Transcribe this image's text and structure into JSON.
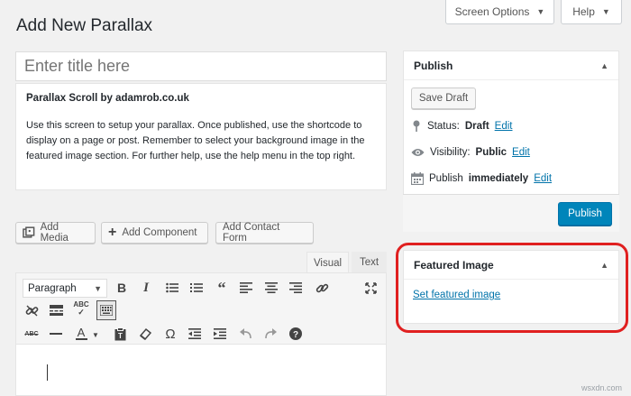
{
  "header": {
    "screen_options": "Screen Options",
    "help": "Help",
    "page_title": "Add New Parallax"
  },
  "title_field": {
    "placeholder": "Enter title here"
  },
  "notice": {
    "heading": "Parallax Scroll by adamrob.co.uk",
    "body": "Use this screen to setup your parallax. Once published, use the shortcode to display on a page or post. Remember to select your background image in the featured image section. For further help, use the help menu in the top right."
  },
  "media_buttons": {
    "add_media": "Add Media",
    "add_component": "Add Component",
    "add_contact_form": "Add Contact Form"
  },
  "editor_tabs": {
    "visual": "Visual",
    "text": "Text"
  },
  "toolbar": {
    "format_select": "Paragraph",
    "row1_icons": [
      "bold-icon",
      "italic-icon",
      "bullet-list-icon",
      "numbered-list-icon",
      "blockquote-icon",
      "align-left-icon",
      "align-center-icon",
      "align-right-icon",
      "link-icon",
      "fullscreen-icon"
    ],
    "row2_icons": [
      "unlink-icon",
      "read-more-icon",
      "spellcheck-icon",
      "toolbar-toggle-icon"
    ],
    "row3_icons": [
      "strikethrough-icon",
      "horizontal-line-icon",
      "text-color-icon",
      "paste-text-icon",
      "clear-formatting-icon",
      "special-character-icon",
      "outdent-icon",
      "indent-icon",
      "undo-icon",
      "redo-icon",
      "help-icon"
    ]
  },
  "publish_box": {
    "title": "Publish",
    "save_draft": "Save Draft",
    "status_label": "Status:",
    "status_value": "Draft",
    "visibility_label": "Visibility:",
    "visibility_value": "Public",
    "publish_label": "Publish",
    "publish_value": "immediately",
    "edit": "Edit",
    "publish_button": "Publish"
  },
  "featured_image_box": {
    "title": "Featured Image",
    "set_link": "Set featured image"
  },
  "watermark": "wsxdn.com",
  "colors": {
    "primary": "#0085ba",
    "link": "#0073aa",
    "highlight": "#e02020"
  }
}
